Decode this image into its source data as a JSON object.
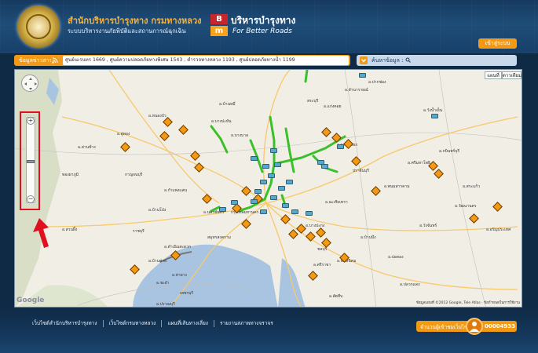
{
  "header": {
    "title": "สำนักบริหารบำรุงทาง  กรมทางหลวง",
    "subtitle": "ระบบบริหารงานภัยพิบัติและสถานการณ์ฉุกเฉิน",
    "brand_mark_top": "B",
    "brand_mark_bottom": "m",
    "brand_th": "บริหารบำรุงทาง",
    "brand_en": "For Better Roads",
    "login_label": "เข้าสู่ระบบ"
  },
  "toolbar": {
    "announce_label": "ข้อมูลข่าวสาร :",
    "ticker_text": "ศูนย์นเรนทร 1669 , ศูนย์ความปลอดภัยทางพิเศษ 1543 , ตำรวจทางหลวง 1193 , ศูนย์ปลอดภัยทางน้ำ 1199",
    "search_label": "ค้นหาข้อมูล :"
  },
  "map": {
    "map_type_buttons": [
      "แผนที่",
      "ดาวเทียม"
    ],
    "zoom_in": "+",
    "zoom_out": "−",
    "google_logo": "Google",
    "attribution": "ข้อมูลแผนที่ ©2012 Google, Tele Atlas · ข้อกำหนดในการใช้งาน",
    "places": [
      {
        "name": "อ.ปากช่อง"
      },
      {
        "name": "อ.ลำนารายณ์"
      },
      {
        "name": "สระบุรี"
      },
      {
        "name": "อ.แก่งคอย"
      },
      {
        "name": "อ.บ้านหมี่"
      },
      {
        "name": "อ.หนองบัว"
      },
      {
        "name": "อ.วังน้ำเย็น"
      },
      {
        "name": "อ.บางปะหัน"
      },
      {
        "name": "อ.อู่ทอง"
      },
      {
        "name": "อ.ด่านช้าง"
      },
      {
        "name": "อ.บางบาล"
      },
      {
        "name": "อ.นครนายก"
      },
      {
        "name": "อ.ศรีมหาโพธิ"
      },
      {
        "name": "ปราจีนบุรี"
      },
      {
        "name": "อ.กบินทร์บุรี"
      },
      {
        "name": "กาญจนบุรี"
      },
      {
        "name": "ทองผาภูมิ"
      },
      {
        "name": "อ.กำแพงแสน"
      },
      {
        "name": "อ.นครชัยศรี"
      },
      {
        "name": "กรุงเทพมหานคร"
      },
      {
        "name": "อ.ฉะเชิงเทรา"
      },
      {
        "name": "อ.พนมสารคาม"
      },
      {
        "name": "อ.บางปะกง"
      },
      {
        "name": "ราชบุรี"
      },
      {
        "name": "อ.บ้านโป่ง"
      },
      {
        "name": "อ.สวนผึ้ง"
      },
      {
        "name": "อ.ดำเนินสะดวก"
      },
      {
        "name": "สมุทรสงคราม"
      },
      {
        "name": "ชลบุรี"
      },
      {
        "name": "อ.ศรีราชา"
      },
      {
        "name": "อ.พนัสนิคม"
      },
      {
        "name": "อ.บ้านบึง"
      },
      {
        "name": "อ.บ่อทอง"
      },
      {
        "name": "อ.วังจันทร์"
      },
      {
        "name": "อ.ปลวกแดง"
      },
      {
        "name": "อ.บ้านค่าย"
      },
      {
        "name": "อ.สัตหีบ"
      },
      {
        "name": "อ.ปราณบุรี"
      },
      {
        "name": "อ.ชะอำ"
      },
      {
        "name": "เพชรบุรี"
      },
      {
        "name": "อ.ท่ายาง"
      },
      {
        "name": "อ.สระแก้ว"
      },
      {
        "name": "อ.วัฒนานคร"
      },
      {
        "name": "อ.อรัญประเทศ"
      }
    ]
  },
  "footer": {
    "links": [
      "เว็บไซต์สำนักบริหารบำรุงทาง",
      "เว็บไซต์กรมทางหลวง",
      "แผนที่เส้นทางเลี่ยง",
      "รายงานสภาพทางจราจร"
    ],
    "visitor_label": "จำนวนผู้เข้าชมเว็บไซต์",
    "visitor_count": "00004933"
  },
  "colors": {
    "accent": "#f29a16",
    "header_bg": "#1e4d78",
    "footer_bg": "#15385c",
    "highlight": "#e01020",
    "road_green": "#39c02b"
  }
}
